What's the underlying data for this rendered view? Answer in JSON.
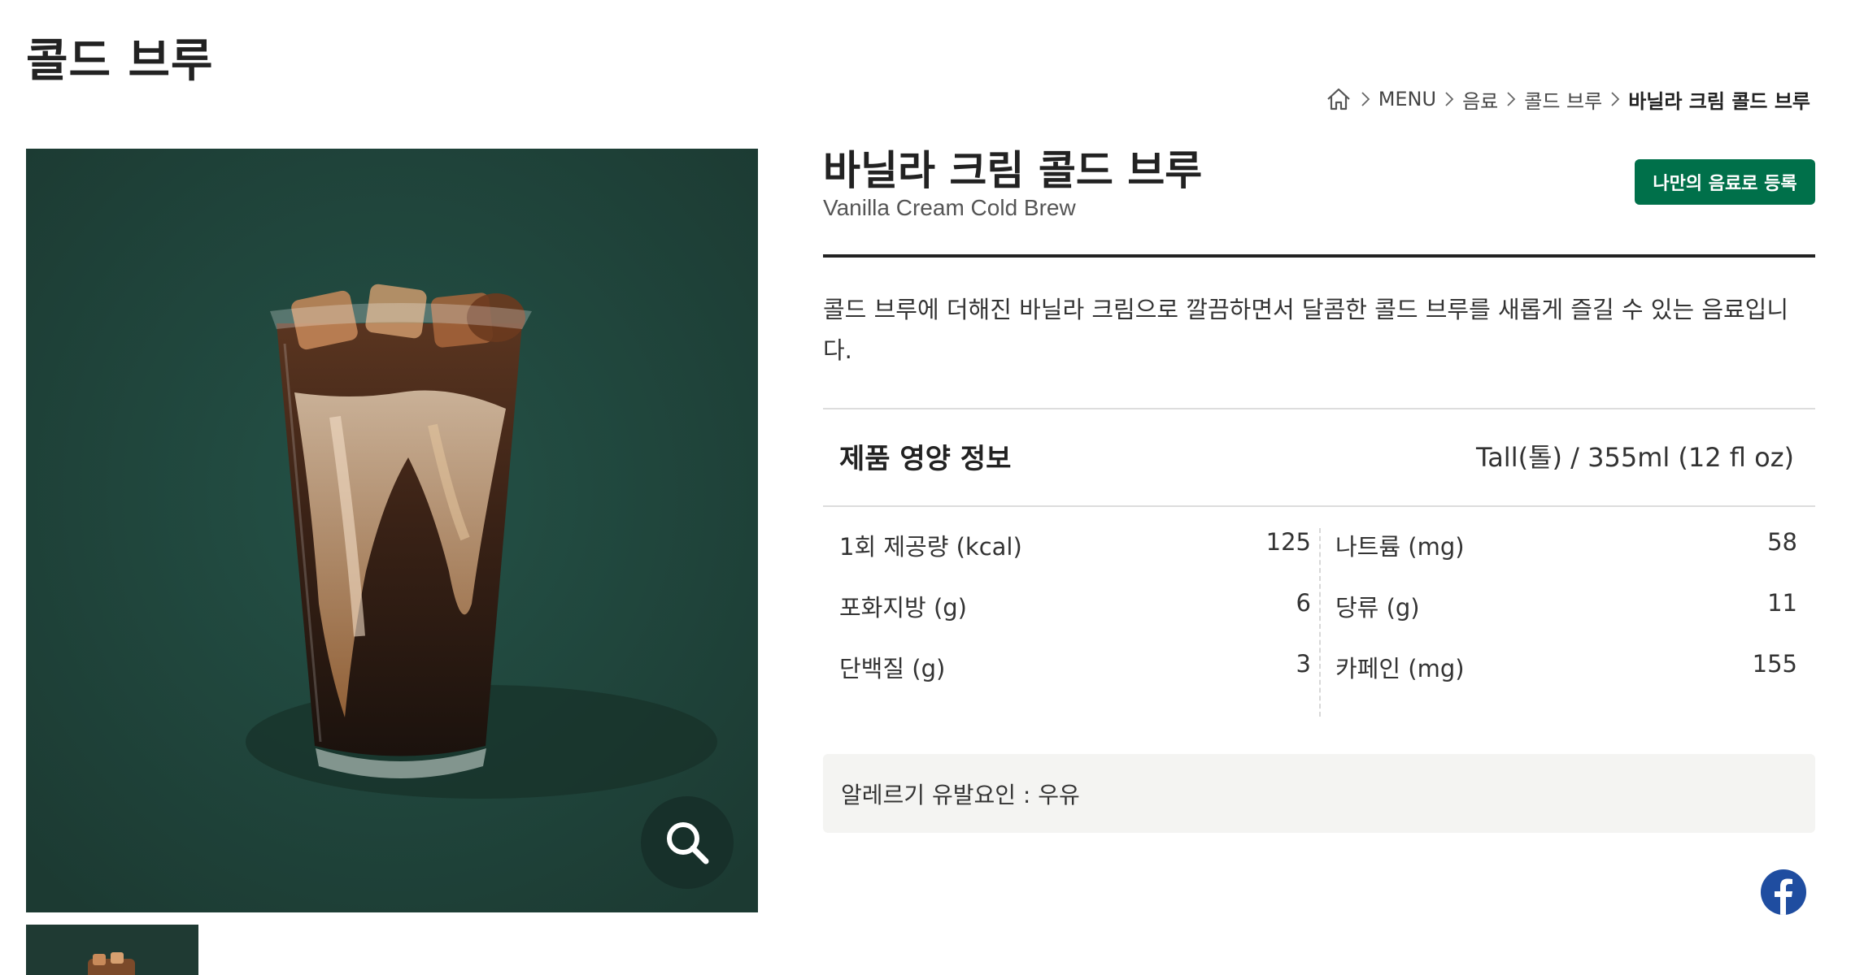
{
  "page": {
    "title": "콜드 브루"
  },
  "breadcrumb": {
    "items": [
      "MENU",
      "음료",
      "콜드 브루"
    ],
    "current": "바닐라 크림 콜드 브루"
  },
  "product": {
    "name": "바닐라 크림 콜드 브루",
    "name_en": "Vanilla Cream Cold Brew",
    "register_label": "나만의 음료로 등록",
    "description": "콜드 브루에 더해진 바닐라 크림으로 깔끔하면서 달콤한 콜드 브루를 새롭게 즐길 수 있는 음료입니다."
  },
  "nutrition": {
    "title": "제품 영양 정보",
    "serving": "Tall(톨) / 355ml (12 fl oz)",
    "left": [
      {
        "label": "1회 제공량 (kcal)",
        "value": "125"
      },
      {
        "label": "포화지방 (g)",
        "value": "6"
      },
      {
        "label": "단백질 (g)",
        "value": "3"
      }
    ],
    "right": [
      {
        "label": "나트륨 (mg)",
        "value": "58"
      },
      {
        "label": "당류 (g)",
        "value": "11"
      },
      {
        "label": "카페인 (mg)",
        "value": "155"
      }
    ]
  },
  "allergy": {
    "text": "알레르기 유발요인 : 우유"
  },
  "colors": {
    "brand_green": "#00704a",
    "hero_bg": "#1f3a33",
    "facebook": "#1f4da0"
  },
  "icons": [
    "home-icon",
    "chevron-right-icon",
    "magnifier-icon",
    "facebook-icon"
  ]
}
